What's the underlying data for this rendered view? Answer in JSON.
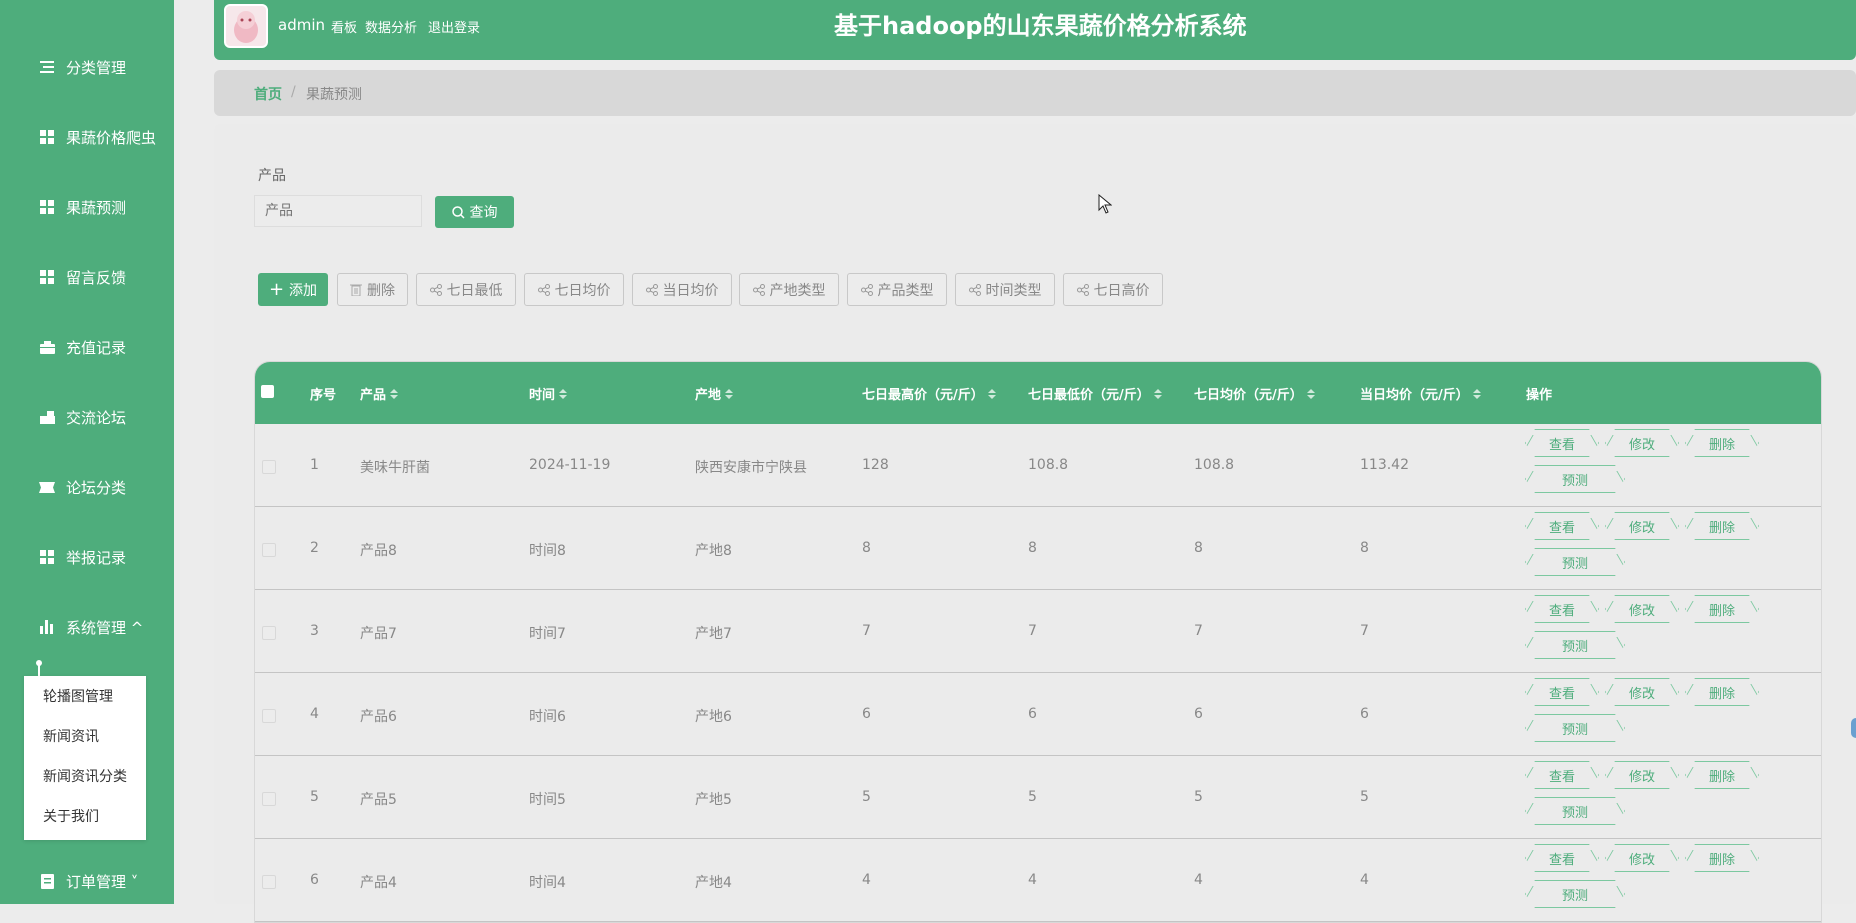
{
  "app": {
    "title": "基于hadoop的山东果蔬价格分析系统"
  },
  "topnav": {
    "user": "admin",
    "links": [
      "看板",
      "数据分析",
      "退出登录"
    ]
  },
  "sidebar": {
    "items": [
      {
        "label": "分类管理",
        "icon": "list-icon"
      },
      {
        "label": "果蔬价格爬虫",
        "icon": "grid-icon"
      },
      {
        "label": "果蔬预测",
        "icon": "grid-icon"
      },
      {
        "label": "留言反馈",
        "icon": "grid-icon"
      },
      {
        "label": "充值记录",
        "icon": "wallet-icon"
      },
      {
        "label": "交流论坛",
        "icon": "forum-icon"
      },
      {
        "label": "论坛分类",
        "icon": "ticket-icon"
      },
      {
        "label": "举报记录",
        "icon": "grid-icon"
      },
      {
        "label": "系统管理 ^",
        "icon": "bar-chart-icon"
      },
      {
        "label": "订单管理 ˅",
        "icon": "document-icon"
      }
    ],
    "submenu": [
      "轮播图管理",
      "新闻资讯",
      "新闻资讯分类",
      "关于我们"
    ]
  },
  "breadcrumb": {
    "home": "首页",
    "separator": "/",
    "current": "果蔬预测"
  },
  "search": {
    "label": "产品",
    "placeholder": "产品",
    "button": "查询"
  },
  "toolbar": {
    "add": "添加",
    "delete": "删除",
    "buttons": [
      "七日最低",
      "七日均价",
      "当日均价",
      "产地类型",
      "产品类型",
      "时间类型",
      "七日高价"
    ]
  },
  "table": {
    "headers": [
      "序号",
      "产品",
      "时间",
      "产地",
      "七日最高价（元/斤）",
      "七日最低价（元/斤）",
      "七日均价（元/斤）",
      "当日均价（元/斤）",
      "操作"
    ],
    "actions": [
      "查看",
      "修改",
      "删除",
      "预测"
    ],
    "rows": [
      {
        "index": "1",
        "product": "美味牛肝菌",
        "time": "2024-11-19",
        "origin": "陕西安康市宁陕县",
        "high7": "128",
        "low7": "108.8",
        "avg7": "108.8",
        "today": "113.42"
      },
      {
        "index": "2",
        "product": "产品8",
        "time": "时间8",
        "origin": "产地8",
        "high7": "8",
        "low7": "8",
        "avg7": "8",
        "today": "8"
      },
      {
        "index": "3",
        "product": "产品7",
        "time": "时间7",
        "origin": "产地7",
        "high7": "7",
        "low7": "7",
        "avg7": "7",
        "today": "7"
      },
      {
        "index": "4",
        "product": "产品6",
        "time": "时间6",
        "origin": "产地6",
        "high7": "6",
        "low7": "6",
        "avg7": "6",
        "today": "6"
      },
      {
        "index": "5",
        "product": "产品5",
        "time": "时间5",
        "origin": "产地5",
        "high7": "5",
        "low7": "5",
        "avg7": "5",
        "today": "5"
      },
      {
        "index": "6",
        "product": "产品4",
        "time": "时间4",
        "origin": "产地4",
        "high7": "4",
        "low7": "4",
        "avg7": "4",
        "today": "4"
      }
    ]
  },
  "colors": {
    "brand": "#4ead7c",
    "sidebar_bg": "#4ead7c",
    "panel_bg": "#ebebeb"
  }
}
